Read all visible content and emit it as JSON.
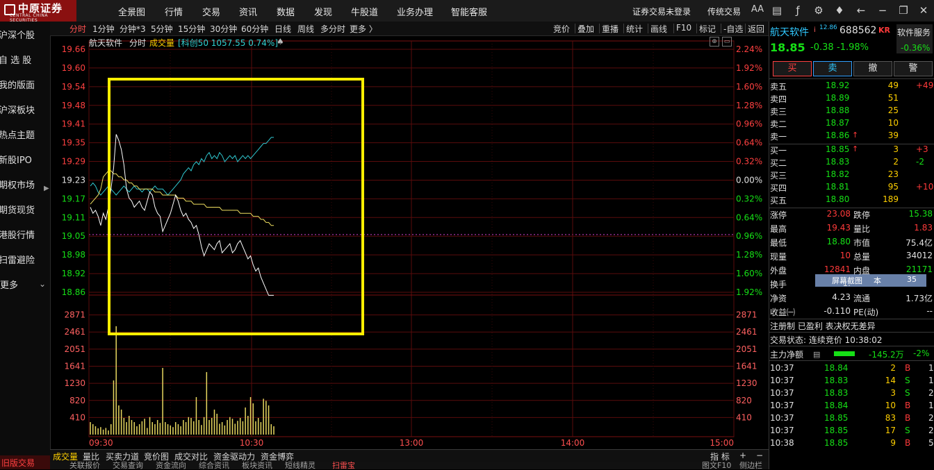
{
  "app": {
    "logo_name": "中原证券",
    "logo_sub": "CENTRAL CHINA SECURITIES"
  },
  "menu": [
    "全景图",
    "行情",
    "交易",
    "资讯",
    "数据",
    "发现",
    "牛股道",
    "业务办理",
    "智能客服"
  ],
  "top_right": {
    "login_status": "证券交易未登录",
    "mode": "传统交易",
    "font_btn": "AA"
  },
  "sidebar": {
    "items": [
      "沪深个股",
      "自 选 股",
      "我的版面",
      "沪深板块",
      "热点主题",
      "新股IPO",
      "期权市场",
      "期货现货",
      "港股行情",
      "扫雷避险",
      "更多"
    ],
    "bottom": "旧版交易"
  },
  "timeframes": [
    "分时",
    "1分钟",
    "分钟*3",
    "5分钟",
    "15分钟",
    "30分钟",
    "60分钟",
    "日线",
    "周线",
    "多分时",
    "更多 〉"
  ],
  "tools": [
    "竞价",
    "叠加",
    "重播",
    "统计",
    "画线",
    "F10",
    "标记",
    "-自选",
    "返回"
  ],
  "chart_info": {
    "name": "航天软件",
    "mode": "分时",
    "indicator": "成交量",
    "index_info": "[科创50 1057.55 0.74%]"
  },
  "chart_data": {
    "type": "line",
    "y_price_ticks": [
      "19.66",
      "19.60",
      "19.54",
      "19.48",
      "19.41",
      "19.35",
      "19.29",
      "19.23",
      "19.17",
      "19.11",
      "19.05",
      "18.98",
      "18.92",
      "18.86"
    ],
    "y_pct_left": [
      "2.24%",
      "1.92%",
      "1.60%",
      "1.28%",
      "0.96%",
      "0.64%",
      "0.32%",
      "0.00%",
      "0.32%",
      "0.64%",
      "0.96%",
      "1.28%",
      "1.60%",
      "1.92%"
    ],
    "volume_ticks": [
      "2871",
      "2461",
      "2051",
      "1641",
      "1230",
      "820",
      "410"
    ],
    "x_labels": [
      "09:30",
      "10:30",
      "13:00",
      "14:00",
      "15:00"
    ],
    "prev_close": 19.23,
    "price_series": [
      19.14,
      19.12,
      19.13,
      19.11,
      19.08,
      19.12,
      19.1,
      19.14,
      19.2,
      19.27,
      19.38,
      19.36,
      19.33,
      19.28,
      19.2,
      19.17,
      19.16,
      19.14,
      19.15,
      19.16,
      19.14,
      19.13,
      19.16,
      19.19,
      19.18,
      19.14,
      19.12,
      19.11,
      19.06,
      19.08,
      19.1,
      19.12,
      19.15,
      19.18,
      19.16,
      19.13,
      19.11,
      19.12,
      19.1,
      19.09,
      19.07,
      19.08,
      19.05,
      19.01,
      18.98,
      19.0,
      19.02,
      19.01,
      19.0,
      19.02,
      19.03,
      18.99,
      19.0,
      19.01,
      19.02,
      18.99,
      19.0,
      19.02,
      19.03,
      19.01,
      18.99,
      18.97,
      18.98,
      18.95,
      18.93,
      18.94,
      18.91,
      18.89,
      18.87,
      18.85,
      18.85,
      18.85
    ],
    "avg_series": [
      19.15,
      19.16,
      19.17,
      19.18,
      19.2,
      19.24,
      19.25,
      19.26,
      19.26,
      19.25,
      19.25,
      19.24,
      19.24,
      19.23,
      19.23,
      19.22,
      19.22,
      19.21,
      19.21,
      19.2,
      19.2,
      19.2,
      19.2,
      19.2,
      19.2,
      19.19,
      19.19,
      19.19,
      19.18,
      19.18,
      19.18,
      19.18,
      19.18,
      19.18,
      19.17,
      19.17,
      19.17,
      19.16,
      19.16,
      19.16,
      19.15,
      19.15,
      19.15,
      19.15,
      19.15,
      19.14,
      19.14,
      19.14,
      19.14,
      19.14,
      19.14,
      19.13,
      19.13,
      19.13,
      19.13,
      19.13,
      19.13,
      19.13,
      19.12,
      19.12,
      19.12,
      19.12,
      19.12,
      19.11,
      19.11,
      19.11,
      19.1,
      19.1,
      19.09,
      19.09,
      19.08,
      19.08
    ],
    "index_series": [
      19.21,
      19.22,
      19.21,
      19.19,
      19.18,
      19.19,
      19.2,
      19.21,
      19.2,
      19.19,
      19.18,
      19.19,
      19.2,
      19.21,
      19.2,
      19.19,
      19.2,
      19.21,
      19.2,
      19.2,
      19.19,
      19.2,
      19.2,
      19.19,
      19.2,
      19.21,
      19.2,
      19.2,
      19.2,
      19.19,
      19.18,
      19.19,
      19.2,
      19.21,
      19.22,
      19.23,
      19.25,
      19.26,
      19.27,
      19.26,
      19.28,
      19.29,
      19.28,
      19.3,
      19.29,
      19.31,
      19.32,
      19.3,
      19.31,
      19.3,
      19.32,
      19.31,
      19.29,
      19.3,
      19.31,
      19.3,
      19.31,
      19.29,
      19.3,
      19.31,
      19.3,
      19.31,
      19.3,
      19.31,
      19.32,
      19.33,
      19.34,
      19.35,
      19.35,
      19.36,
      19.37,
      19.37
    ],
    "volume_series": [
      300,
      250,
      200,
      150,
      180,
      120,
      160,
      100,
      250,
      1300,
      2600,
      700,
      600,
      400,
      300,
      450,
      350,
      300,
      200,
      250,
      320,
      380,
      160,
      420,
      300,
      250,
      350,
      280,
      1600,
      300,
      250,
      220,
      180,
      300,
      250,
      200,
      350,
      300,
      420,
      400,
      320,
      900,
      350,
      230,
      420,
      1500,
      350,
      400,
      600,
      500,
      260,
      300,
      220,
      350,
      420,
      380,
      260,
      330,
      400,
      320,
      650,
      450,
      900,
      750,
      320,
      400,
      300,
      860,
      810,
      700,
      250,
      200
    ],
    "grid": true
  },
  "highlight_box_color": "#ffee00",
  "bottom_tabs": [
    "成交量",
    "量比",
    "买卖力道",
    "竞价图",
    "成交对比",
    "资金驱动力",
    "资金博弈"
  ],
  "bottom_right": {
    "indicator_btn": "指 标",
    "plus": "+",
    "minus": "−"
  },
  "bottom_strip": [
    "关联报价",
    "交易查询",
    "资金流向",
    "综合资讯",
    "板块资讯",
    "短线精灵",
    "扫雷宝",
    "图文F10",
    "侧边栏"
  ],
  "quote": {
    "name": "航天软件",
    "flag": "i",
    "ref": "12.86",
    "code": "688562",
    "kr": "KR",
    "sector_btn": "软件服务",
    "price": "18.85",
    "change": "-0.38",
    "change_pct": "-1.98%",
    "sector_pct": "-0.36%",
    "buttons": [
      "买",
      "卖",
      "撤",
      "警"
    ],
    "asks": [
      {
        "label": "卖五",
        "price": "18.92",
        "vol": "49",
        "chg": "+49"
      },
      {
        "label": "卖四",
        "price": "18.89",
        "vol": "51",
        "chg": ""
      },
      {
        "label": "卖三",
        "price": "18.88",
        "vol": "25",
        "chg": ""
      },
      {
        "label": "卖二",
        "price": "18.87",
        "vol": "10",
        "chg": ""
      },
      {
        "label": "卖一",
        "price": "18.86",
        "vol": "39",
        "chg": ""
      }
    ],
    "bids": [
      {
        "label": "买一",
        "price": "18.85",
        "vol": "3",
        "chg": "+3"
      },
      {
        "label": "买二",
        "price": "18.83",
        "vol": "2",
        "chg": "-2"
      },
      {
        "label": "买三",
        "price": "18.82",
        "vol": "23",
        "chg": ""
      },
      {
        "label": "买四",
        "price": "18.81",
        "vol": "95",
        "chg": "+10"
      },
      {
        "label": "买五",
        "price": "18.80",
        "vol": "189",
        "chg": ""
      }
    ],
    "stats": [
      {
        "l1": "涨停",
        "v1": "23.08",
        "l2": "跌停",
        "v2": "15.38"
      },
      {
        "l1": "最高",
        "v1": "19.43",
        "l2": "量比",
        "v2": "1.83"
      },
      {
        "l1": "最低",
        "v1": "18.80",
        "l2": "市值",
        "v2": "75.4亿"
      },
      {
        "l1": "现量",
        "v1": "10",
        "l2": "总量",
        "v2": "34012"
      },
      {
        "l1": "外盘",
        "v1": "12841",
        "l2": "内盘",
        "v2": "21171"
      },
      {
        "l1": "换手",
        "v1": "1.",
        "l2": "",
        "v2": ""
      },
      {
        "l1": "净资",
        "v1": "4.23",
        "l2": "流通",
        "v2": "1.73亿"
      },
      {
        "l1": "收益㈠",
        "v1": "-0.110",
        "l2": "PE(动)",
        "v2": "--"
      }
    ],
    "screenshot_popup": {
      "label": "屏幕截图",
      "a": "本",
      "b": "35"
    },
    "tags": "注册制 已盈利 表决权无差异",
    "trade_status": "交易状态: 连续竞价 10:38:02",
    "main_flow": {
      "label": "主力净额",
      "value": "-145.2万",
      "pct": "-2%"
    },
    "ticks": [
      {
        "t": "10:37",
        "p": "18.84",
        "v": "2",
        "s": "B",
        "n": "1"
      },
      {
        "t": "10:37",
        "p": "18.83",
        "v": "14",
        "s": "S",
        "n": "1"
      },
      {
        "t": "10:37",
        "p": "18.83",
        "v": "3",
        "s": "S",
        "n": "2"
      },
      {
        "t": "10:37",
        "p": "18.84",
        "v": "10",
        "s": "B",
        "n": "1"
      },
      {
        "t": "10:37",
        "p": "18.85",
        "v": "83",
        "s": "B",
        "n": "2"
      },
      {
        "t": "10:37",
        "p": "18.85",
        "v": "17",
        "s": "S",
        "n": "2"
      },
      {
        "t": "10:38",
        "p": "18.85",
        "v": "9",
        "s": "B",
        "n": "5"
      }
    ]
  }
}
